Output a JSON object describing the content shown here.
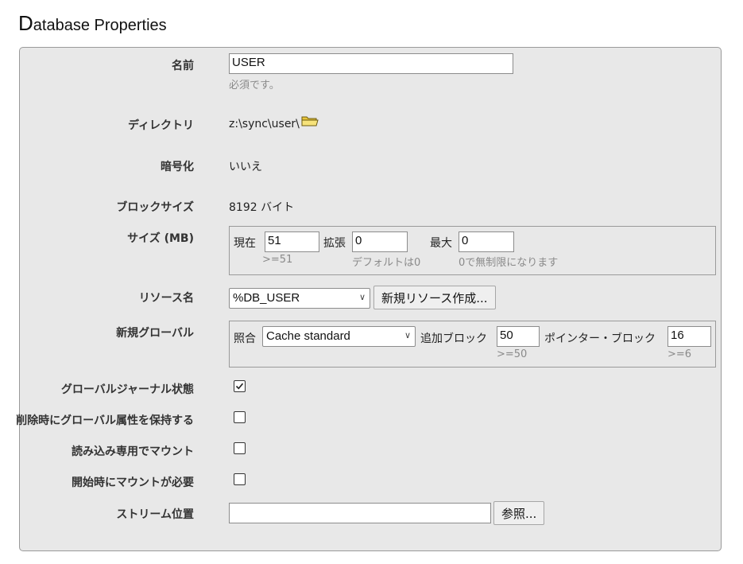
{
  "page": {
    "title_initial": "D",
    "title_rest": "atabase Properties"
  },
  "fields": {
    "name": {
      "label": "名前",
      "value": "USER",
      "hint": "必須です。"
    },
    "directory": {
      "label": "ディレクトリ",
      "value": "z:\\sync\\user\\",
      "icon": "folder-icon"
    },
    "encryption": {
      "label": "暗号化",
      "value": "いいえ"
    },
    "block_size": {
      "label": "ブロックサイズ",
      "value": "8192 バイト"
    },
    "size": {
      "label": "サイズ (MB)",
      "current_label": "現在",
      "current_value": "51",
      "current_hint": ">=51",
      "expand_label": "拡張",
      "expand_value": "0",
      "expand_hint": "デフォルトは0",
      "max_label": "最大",
      "max_value": "0",
      "max_hint": "0で無制限になります"
    },
    "resource": {
      "label": "リソース名",
      "value": "%DB_USER",
      "button": "新規リソース作成..."
    },
    "new_global": {
      "label": "新規グローバル",
      "collation_label": "照合",
      "collation_value": "Cache standard",
      "extra_block_label": "追加ブロック",
      "extra_block_value": "50",
      "extra_block_hint": ">=50",
      "pointer_block_label": "ポインター・ブロック",
      "pointer_block_value": "16",
      "pointer_block_hint": ">=6"
    },
    "global_journal": {
      "label": "グローバルジャーナル状態",
      "checked": true
    },
    "preserve_global": {
      "label": "削除時にグローバル属性を保持する",
      "checked": false
    },
    "mount_readonly": {
      "label": "読み込み専用でマウント",
      "checked": false
    },
    "mount_required": {
      "label": "開始時にマウントが必要",
      "checked": false
    },
    "stream_location": {
      "label": "ストリーム位置",
      "value": "",
      "button": "参照..."
    }
  },
  "colors": {
    "panel_bg": "#e8e8e8",
    "hint": "#8a8a8a",
    "folder": "#f2d64b"
  }
}
